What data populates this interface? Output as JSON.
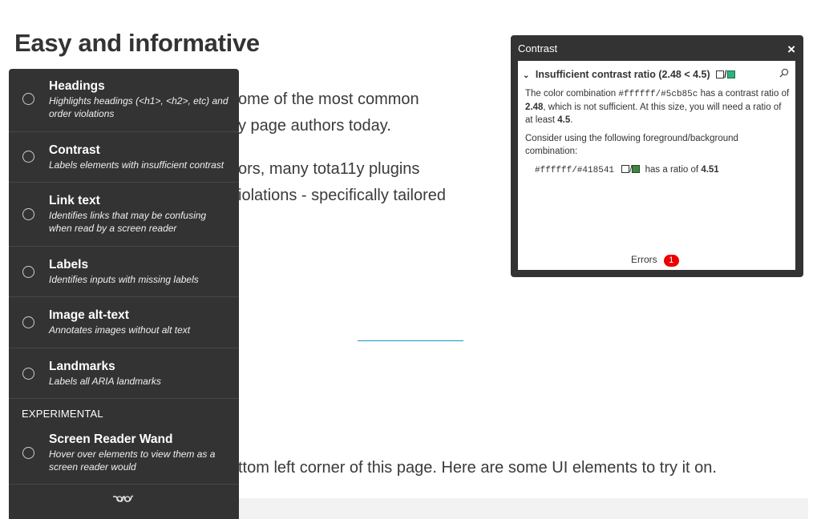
{
  "page": {
    "title": "Easy and informative",
    "para1_line1": "ome of the most common",
    "para1_line2": "y page authors today.",
    "para2_line1": "ors, many tota11y plugins",
    "para2_line2": "iolations - specifically tailored",
    "para3": "ttom left corner of this page. Here are some UI elements to try it on."
  },
  "sidebar": {
    "plugins": [
      {
        "name": "Headings",
        "description": "Highlights headings (<h1>, <h2>, etc) and order violations"
      },
      {
        "name": "Contrast",
        "description": "Labels elements with insufficient contrast"
      },
      {
        "name": "Link text",
        "description": "Identifies links that may be confusing when read by a screen reader"
      },
      {
        "name": "Labels",
        "description": "Identifies inputs with missing labels"
      },
      {
        "name": "Image alt-text",
        "description": "Annotates images without alt text"
      },
      {
        "name": "Landmarks",
        "description": "Labels all ARIA landmarks"
      }
    ],
    "experimental_label": "EXPERIMENTAL",
    "experimental_plugins": [
      {
        "name": "Screen Reader Wand",
        "description": "Hover over elements to view them as a screen reader would"
      }
    ],
    "footer_icon": "glasses-icon"
  },
  "contrast_panel": {
    "title": "Contrast",
    "close_label": "×",
    "issue_heading": "Insufficient contrast ratio (2.48 < 4.5)",
    "text_a": "The color combination ",
    "combo": "#ffffff/#5cb85c",
    "text_b": " has a contrast ratio of ",
    "ratio": "2.48",
    "text_c": ", which is not sufficient. At this size, you will need a ratio of at least ",
    "required": "4.5",
    "text_d": ".",
    "consider": "Consider using the following foreground/background combination:",
    "suggest_combo": "#ffffff/#418541",
    "suggest_text": " has a ratio of ",
    "suggest_ratio": "4.51",
    "errors_label": "Errors",
    "errors_count": "1"
  },
  "colors": {
    "panel_bg": "#333333",
    "accent_link": "#1a95c7",
    "error_badge": "#ee0000",
    "swatch_green": "#5cb85c",
    "swatch_dark_green": "#418541"
  }
}
